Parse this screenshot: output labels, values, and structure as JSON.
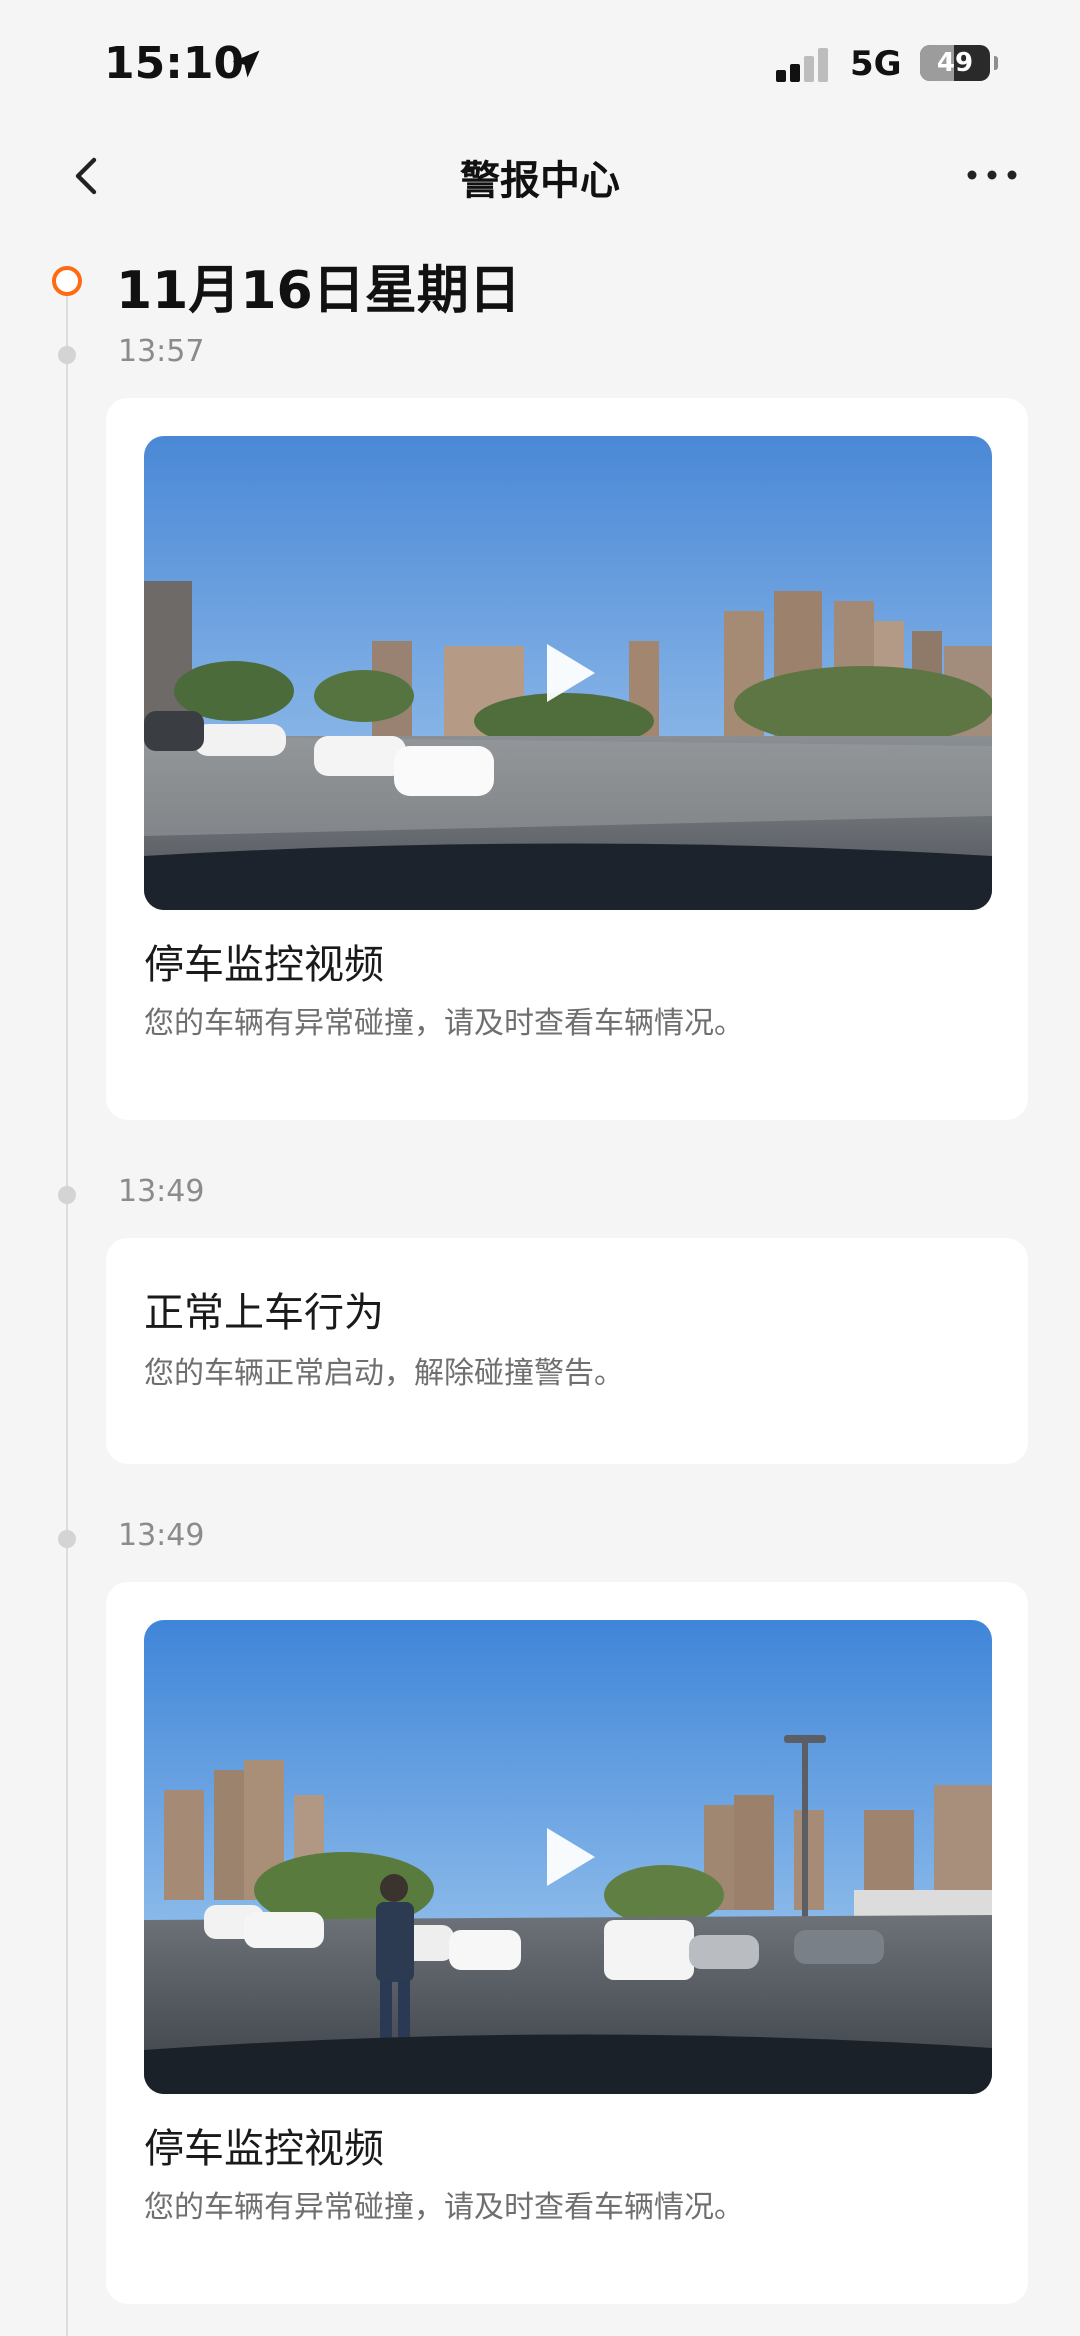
{
  "status_bar": {
    "time": "15:10",
    "network": "5G",
    "battery": "49",
    "battery_level": 0.49,
    "location_icon": "location-arrow-icon",
    "signal_icon": "cellular-signal-icon"
  },
  "nav": {
    "title": "警报中心",
    "back_icon": "chevron-left-icon",
    "more_icon": "more-dots-icon"
  },
  "timeline": {
    "date": "11月16日星期日",
    "accent_color": "#ff6a13",
    "events": [
      {
        "time": "13:57",
        "title": "停车监控视频",
        "description": "您的车辆有异常碰撞，请及时查看车辆情况。",
        "has_video": true,
        "play_icon": "play-icon"
      },
      {
        "time": "13:49",
        "title": "正常上车行为",
        "description": "您的车辆正常启动，解除碰撞警告。",
        "has_video": false
      },
      {
        "time": "13:49",
        "title": "停车监控视频",
        "description": "您的车辆有异常碰撞，请及时查看车辆情况。",
        "has_video": true,
        "play_icon": "play-icon"
      }
    ]
  }
}
